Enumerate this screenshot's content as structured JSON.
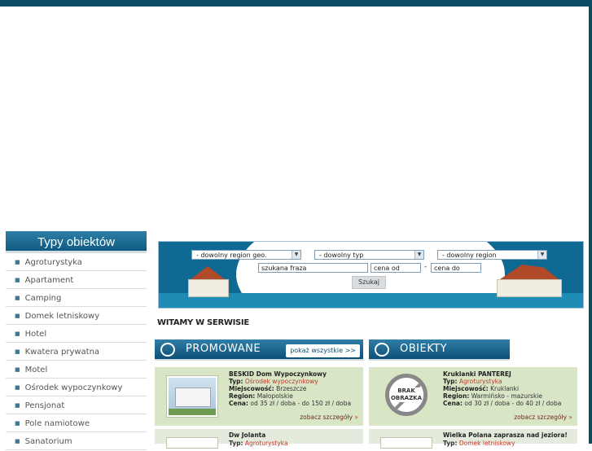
{
  "sidebar": {
    "header": "Typy obiektów",
    "items": [
      {
        "label": "Agroturystyka"
      },
      {
        "label": "Apartament"
      },
      {
        "label": "Camping"
      },
      {
        "label": "Domek letniskowy"
      },
      {
        "label": "Hotel"
      },
      {
        "label": "Kwatera prywatna"
      },
      {
        "label": "Motel"
      },
      {
        "label": "Ośrodek wypoczynkowy"
      },
      {
        "label": "Pensjonat"
      },
      {
        "label": "Pole namiotowe"
      },
      {
        "label": "Sanatorium"
      }
    ]
  },
  "search": {
    "region_geo": "- dowolny region geo.",
    "type": "- dowolny typ",
    "region": "- dowolny region",
    "phrase": "szukana fraza",
    "price_from": "cena od",
    "price_sep": "-",
    "price_to": "cena do",
    "submit": "Szukaj"
  },
  "welcome": "WITAMY W SERWISIE",
  "promoted": {
    "title": "PROMOWANE",
    "more": "pokaż wszystkie >>"
  },
  "objects": {
    "title": "OBIEKTY"
  },
  "labels": {
    "type": "Typ:",
    "locality": "Miejscowość:",
    "region": "Region:",
    "price": "Cena:",
    "details": "zobacz szczegóły",
    "details_arrow": "»",
    "no_image": "BRAK OBRAZKA"
  },
  "cards": [
    {
      "name": "BESKID Dom Wypoczynkowy",
      "type": "Ośrodek wypoczynkowy",
      "locality": "Brzeszcze",
      "region": "Małopolskie",
      "price": "od 35 zł / doba - do 150 zł / doba"
    },
    {
      "name": "Kruklanki PANTEREJ",
      "type": "Agroturystyka",
      "locality": "Kruklanki",
      "region": "Warmińsko - mazurskie",
      "price": "od 30 zł / doba - do 40 zł / doba"
    },
    {
      "name": "Dw Jolanta",
      "type": "Agroturystyka"
    },
    {
      "name": "Wielka Polana zaprasza nad jeziora!",
      "type": "Domek letniskowy"
    }
  ],
  "colors": {
    "brand_dark": "#0d4c63",
    "header_blue": "#1f6f99",
    "card_green": "#d9e6c5",
    "accent_red": "#c0392b"
  }
}
